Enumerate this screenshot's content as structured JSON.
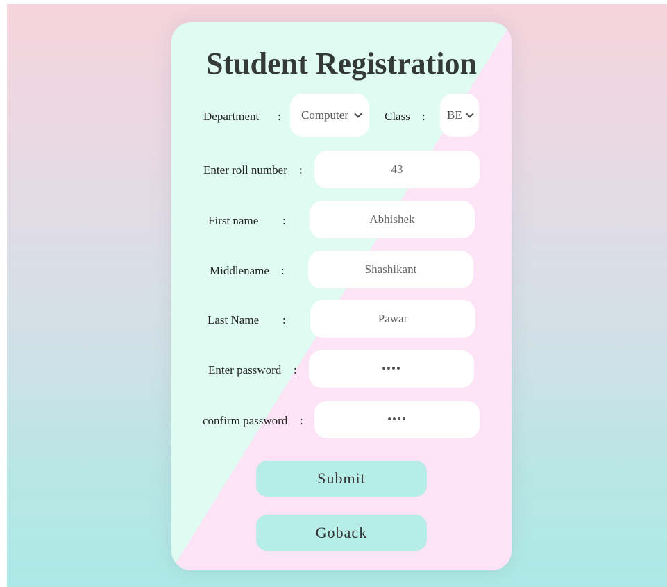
{
  "form": {
    "title": "Student Registration",
    "department": {
      "label": "Department",
      "colon": ":",
      "value": "Computer"
    },
    "class": {
      "label": "Class",
      "colon": ":",
      "value": "BE"
    },
    "roll_number": {
      "label": "Enter roll number",
      "colon": ":",
      "value": "43"
    },
    "first_name": {
      "label": "First name",
      "colon": ":",
      "value": "Abhishek"
    },
    "middle_name": {
      "label": "Middlename",
      "colon": ":",
      "value": "Shashikant"
    },
    "last_name": {
      "label": "Last Name",
      "colon": ":",
      "value": "Pawar"
    },
    "password": {
      "label": "Enter password",
      "colon": ":",
      "value": "••••"
    },
    "confirm_password": {
      "label": "confirm password",
      "colon": ":",
      "value": "••••"
    },
    "submit_label": "Submit",
    "goback_label": "Goback"
  },
  "colors": {
    "card_top_left": "#e0fbf2",
    "card_bottom_right": "#fde3f6",
    "button_bg": "#b6ede6",
    "page_top": "#f6d4dc",
    "page_bottom": "#ace9e6"
  }
}
